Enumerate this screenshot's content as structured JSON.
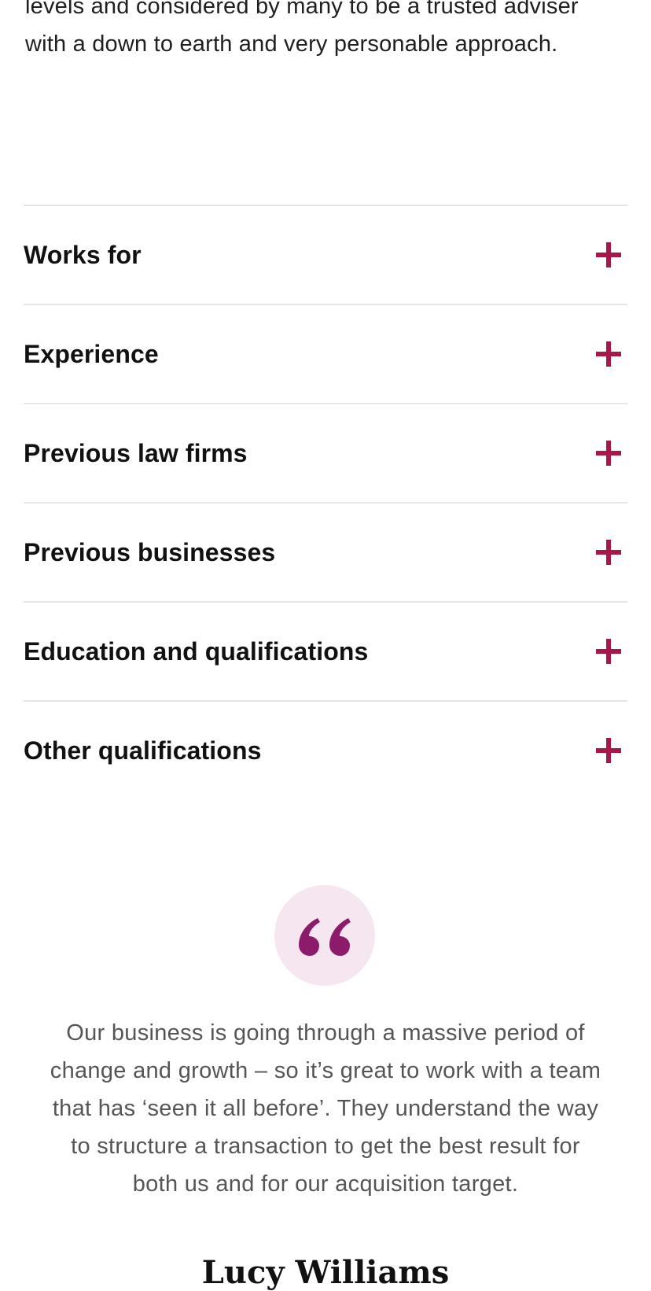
{
  "intro": {
    "text": "levels and considered by many to be a trusted adviser with a down to earth and very personable approach."
  },
  "accordion": {
    "items": [
      {
        "label": "Works for",
        "icon": "plus-icon"
      },
      {
        "label": "Experience",
        "icon": "plus-icon"
      },
      {
        "label": "Previous law firms",
        "icon": "plus-icon"
      },
      {
        "label": "Previous businesses",
        "icon": "plus-icon"
      },
      {
        "label": "Education and qualifications",
        "icon": "plus-icon"
      },
      {
        "label": "Other qualifications",
        "icon": "plus-icon"
      }
    ]
  },
  "testimonial": {
    "icon": "quote-icon",
    "quote": "Our business is going through a massive period of change and growth – so it’s great to work with a team that has ‘seen it all before’. They understand the way to structure a transaction to get the best result for both us and for our acquisition target.",
    "author": "Lucy Williams"
  },
  "colors": {
    "accent": "#a8174a",
    "quote_icon": "#8c1c6b",
    "quote_badge_bg": "#f5e6ef",
    "divider": "#e6e6e6"
  }
}
